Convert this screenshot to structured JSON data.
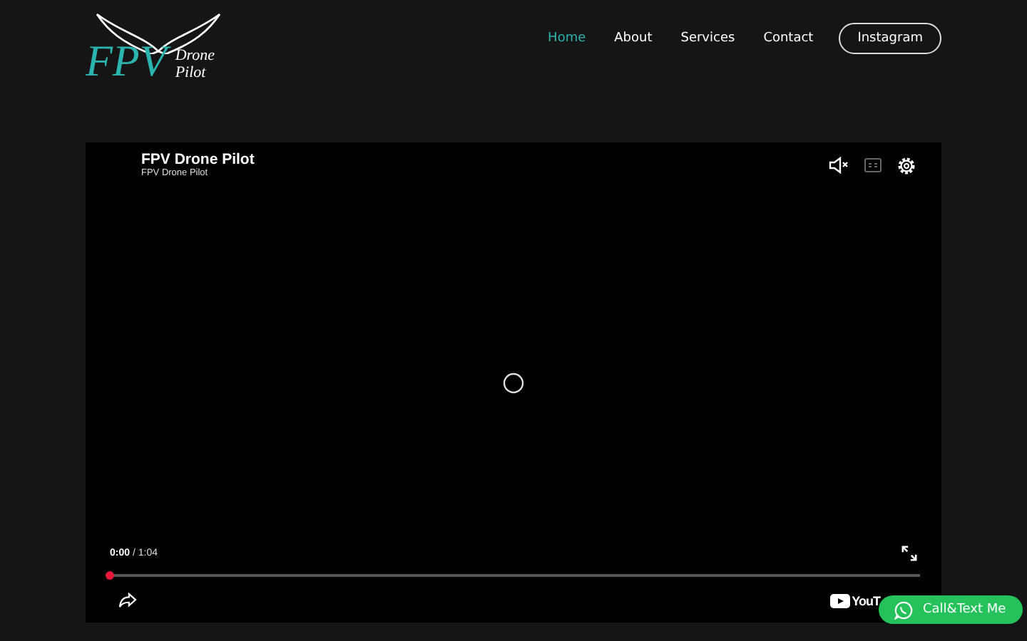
{
  "logo": {
    "mark": "FPV",
    "line1": "Drone",
    "line2": "Pilot"
  },
  "nav": [
    {
      "label": "Home",
      "selected": true
    },
    {
      "label": "About",
      "selected": false
    },
    {
      "label": "Services",
      "selected": false
    },
    {
      "label": "Contact",
      "selected": false
    }
  ],
  "nav_button": "Instagram",
  "video": {
    "title": "FPV Drone Pilot",
    "channel": "FPV Drone Pilot",
    "muted": true,
    "time": "0:00",
    "duration": "/ 1:04",
    "progress": {
      "level": 0
    },
    "brand": "YouT"
  },
  "float_button": "Call&Text Me"
}
